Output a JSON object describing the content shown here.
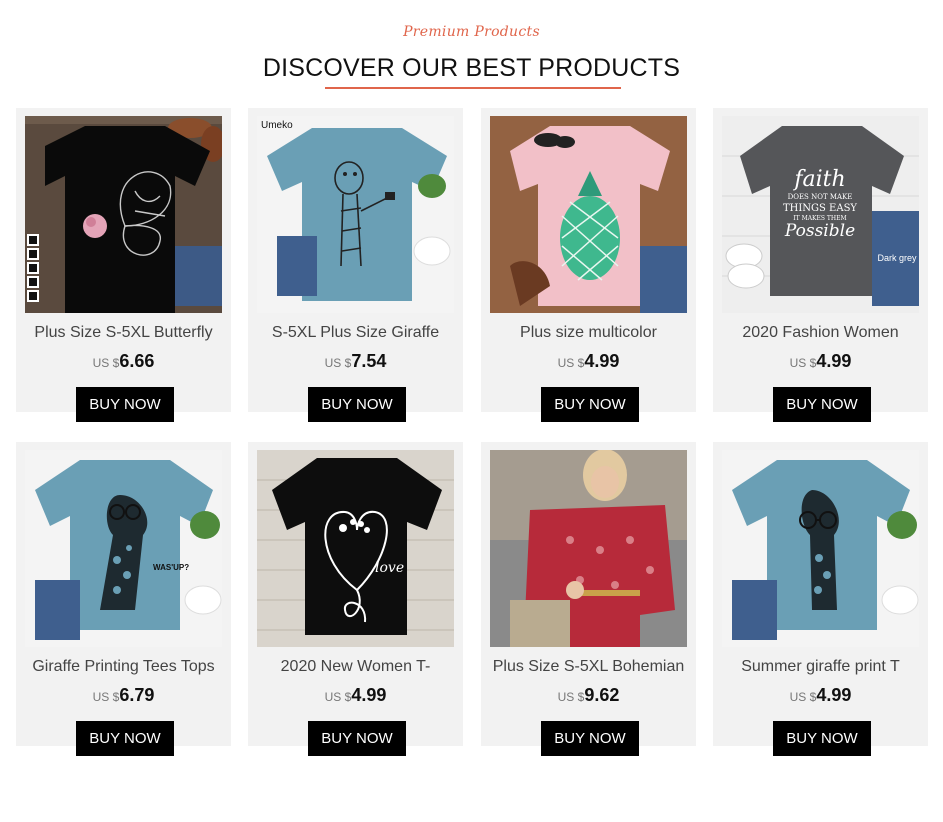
{
  "header": {
    "subtitle": "Premium Products",
    "title": "DISCOVER OUR BEST PRODUCTS",
    "accent_color": "#e0654b"
  },
  "products": [
    {
      "name": "Plus Size S-5XL Butterfly",
      "currency": "US $",
      "price": "6.66",
      "button": "BUY NOW",
      "image": "black-butterfly-tshirt"
    },
    {
      "name": "S-5XL Plus Size Giraffe",
      "currency": "US $",
      "price": "7.54",
      "button": "BUY NOW",
      "image": "blue-giraffe-tshirt",
      "image_label": "Umeko"
    },
    {
      "name": "Plus size multicolor",
      "currency": "US $",
      "price": "4.99",
      "button": "BUY NOW",
      "image": "pink-pineapple-tshirt"
    },
    {
      "name": "2020 Fashion Women",
      "currency": "US $",
      "price": "4.99",
      "button": "BUY NOW",
      "image": "gray-faith-tshirt",
      "image_label": "Dark grey",
      "image_text": [
        "faith",
        "DOES NOT MAKE",
        "THINGS EASY",
        "IT MAKES THEM",
        "Possible"
      ]
    },
    {
      "name": "Giraffe Printing Tees Tops",
      "currency": "US $",
      "price": "6.79",
      "button": "BUY NOW",
      "image": "blue-giraffe-wassup-tshirt",
      "image_text": [
        "WAS'UP?"
      ]
    },
    {
      "name": "2020 New Women T-",
      "currency": "US $",
      "price": "4.99",
      "button": "BUY NOW",
      "image": "black-paw-love-tshirt",
      "image_text": [
        "love"
      ]
    },
    {
      "name": "Plus Size S-5XL Bohemian",
      "currency": "US $",
      "price": "9.62",
      "button": "BUY NOW",
      "image": "red-bohemian-blouse"
    },
    {
      "name": "Summer giraffe print T",
      "currency": "US $",
      "price": "4.99",
      "button": "BUY NOW",
      "image": "blue-giraffe-glasses-tshirt"
    }
  ]
}
